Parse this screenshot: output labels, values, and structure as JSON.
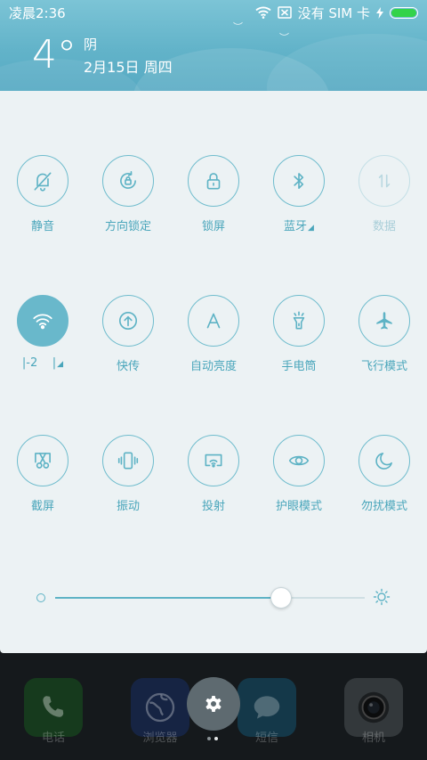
{
  "status_bar": {
    "time": "凌晨2:36",
    "carrier": "没有 SIM 卡"
  },
  "weather": {
    "temperature": "4°",
    "condition": "阴",
    "date": "2月15日 周四"
  },
  "toggles": [
    {
      "name": "toggle-mute",
      "icon": "bell-off-icon",
      "label": "静音",
      "state": "off"
    },
    {
      "name": "toggle-rotation-lock",
      "icon": "rotation-lock-icon",
      "label": "方向锁定",
      "state": "off"
    },
    {
      "name": "toggle-lock-screen",
      "icon": "lock-icon",
      "label": "锁屏",
      "state": "off"
    },
    {
      "name": "toggle-bluetooth",
      "icon": "bluetooth-icon",
      "label": "蓝牙",
      "state": "off"
    },
    {
      "name": "toggle-data",
      "icon": "data-arrows-icon",
      "label": "数据",
      "state": "disabled"
    },
    {
      "name": "toggle-wifi",
      "icon": "wifi-icon",
      "label": "|-2",
      "state": "on"
    },
    {
      "name": "toggle-quick-transfer",
      "icon": "upload-icon",
      "label": "快传",
      "state": "off"
    },
    {
      "name": "toggle-auto-brightness",
      "icon": "letter-a-icon",
      "label": "自动亮度",
      "state": "off"
    },
    {
      "name": "toggle-flashlight",
      "icon": "flashlight-icon",
      "label": "手电筒",
      "state": "off"
    },
    {
      "name": "toggle-airplane",
      "icon": "airplane-icon",
      "label": "飞行模式",
      "state": "off"
    },
    {
      "name": "toggle-screenshot",
      "icon": "scissors-icon",
      "label": "截屏",
      "state": "off"
    },
    {
      "name": "toggle-vibrate",
      "icon": "vibrate-icon",
      "label": "振动",
      "state": "off"
    },
    {
      "name": "toggle-cast",
      "icon": "cast-icon",
      "label": "投射",
      "state": "off"
    },
    {
      "name": "toggle-eye-care",
      "icon": "eye-icon",
      "label": "护眼模式",
      "state": "off"
    },
    {
      "name": "toggle-do-not-disturb",
      "icon": "moon-icon",
      "label": "勿扰模式",
      "state": "off"
    }
  ],
  "brightness": {
    "level": 0.73
  },
  "dock": [
    {
      "name": "dock-app-phone",
      "icon": "phone-icon",
      "label": "电话",
      "color": "#2f8a3a"
    },
    {
      "name": "dock-app-browser",
      "icon": "globe-icon",
      "label": "浏览器",
      "color": "#2d4f9a"
    },
    {
      "name": "dock-app-messages",
      "icon": "chat-bubble-icon",
      "label": "短信",
      "color": "#2c8fb0"
    },
    {
      "name": "dock-app-camera",
      "icon": "camera-icon",
      "label": "相机",
      "color": "#6e7478"
    }
  ],
  "colors": {
    "accent": "#5eb3c5",
    "panel_bg": "#ecf2f4",
    "header_bg": "#62b3c9"
  }
}
